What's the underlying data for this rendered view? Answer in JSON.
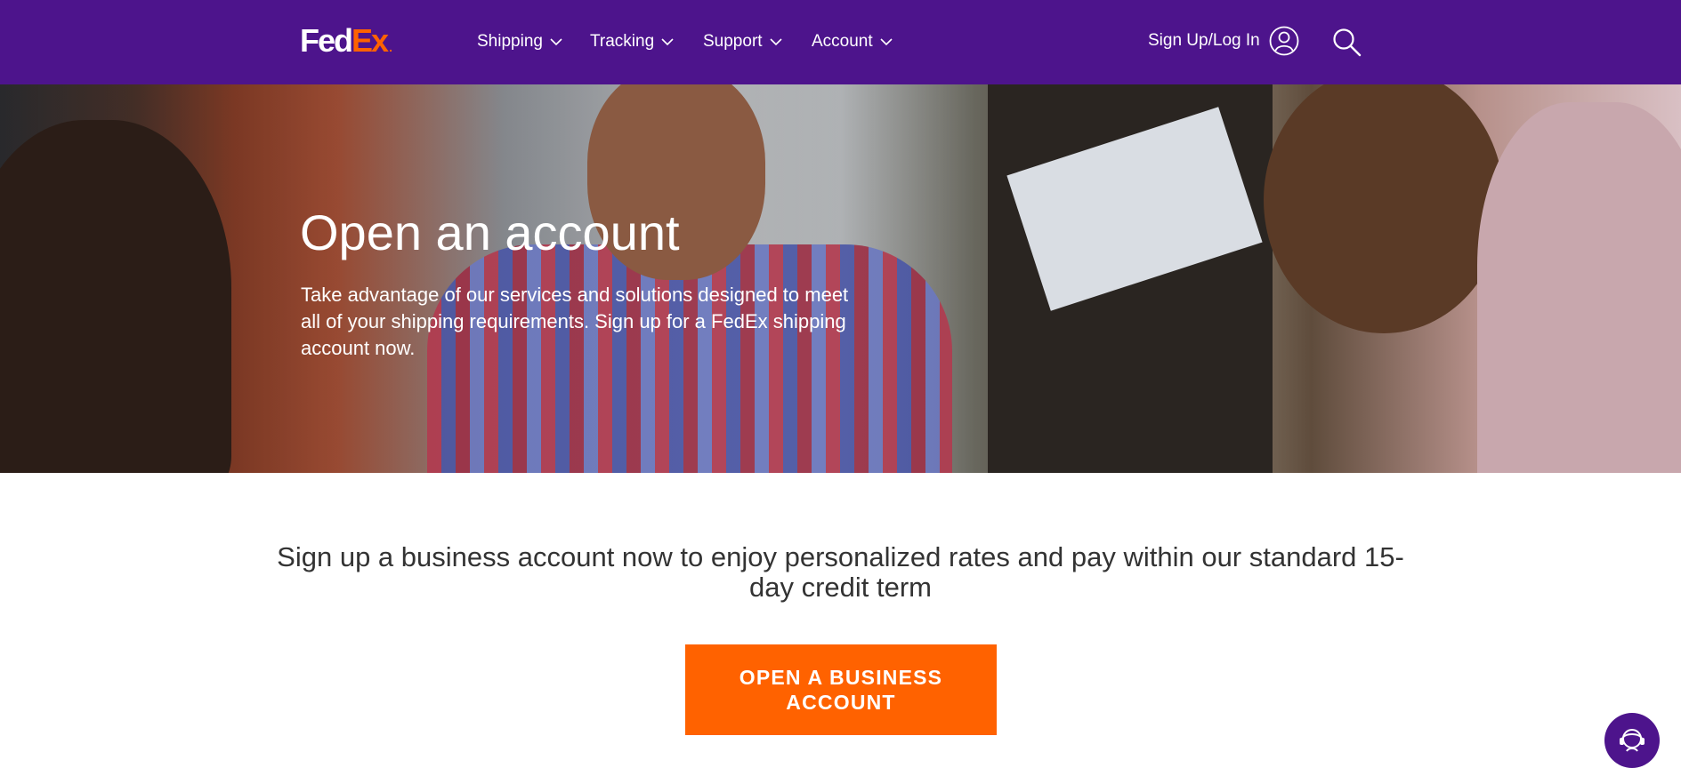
{
  "brand": {
    "logo_fed": "Fed",
    "logo_ex": "Ex",
    "logo_dot": "."
  },
  "colors": {
    "header_bg": "#4d148c",
    "accent": "#ff6200",
    "text": "#333333"
  },
  "nav": {
    "items": [
      {
        "label": "Shipping",
        "icon": "chevron-down-icon"
      },
      {
        "label": "Tracking",
        "icon": "chevron-down-icon"
      },
      {
        "label": "Support",
        "icon": "chevron-down-icon"
      },
      {
        "label": "Account",
        "icon": "chevron-down-icon"
      }
    ],
    "signup_label": "Sign Up/Log In",
    "signup_icon": "user-icon",
    "search_icon": "search-icon"
  },
  "hero": {
    "title": "Open an account",
    "description": "Take advantage of our services and solutions designed to meet all of your shipping requirements. Sign up for a FedEx shipping account now."
  },
  "main": {
    "lead_text": "Sign up a business account now to enjoy personalized rates and pay within our standard 15-day credit term",
    "cta_label": "OPEN A BUSINESS ACCOUNT"
  },
  "chat": {
    "icon": "chat-support-icon"
  }
}
